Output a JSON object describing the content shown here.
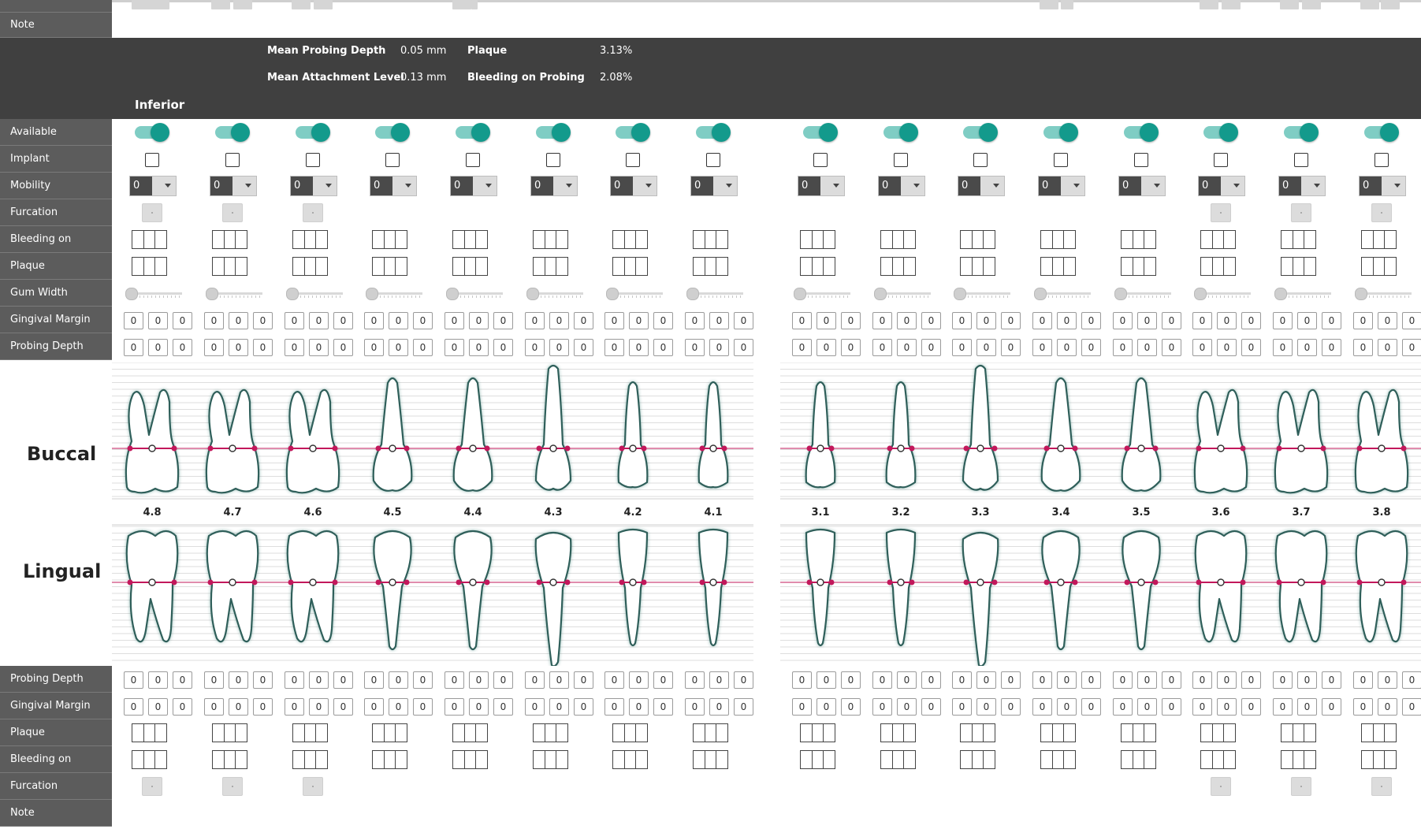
{
  "top_rows": {
    "note": "Note"
  },
  "stats": {
    "mean_probing_depth_label": "Mean Probing Depth",
    "mean_probing_depth_value": "0.05 mm",
    "mean_attachment_level_label": "Mean Attachment Level",
    "mean_attachment_level_value": "0.13 mm",
    "plaque_label": "Plaque",
    "plaque_value": "3.13%",
    "bleeding_label": "Bleeding on Probing",
    "bleeding_value": "2.08%"
  },
  "jaw": "Inferior",
  "rows_upper": [
    "Available",
    "Implant",
    "Mobility",
    "Furcation",
    "Bleeding on Probing",
    "Plaque",
    "Gum Width",
    "Gingival Margin",
    "Probing Depth"
  ],
  "rows_lower": [
    "Probing Depth",
    "Gingival Margin",
    "Plaque",
    "Bleeding on Probing",
    "Furcation",
    "Note"
  ],
  "section_labels": {
    "buccal": "Buccal",
    "lingual": "Lingual"
  },
  "teeth": [
    "4.8",
    "4.7",
    "4.6",
    "4.5",
    "4.4",
    "4.3",
    "4.2",
    "4.1",
    "3.1",
    "3.2",
    "3.3",
    "3.4",
    "3.5",
    "3.6",
    "3.7",
    "3.8"
  ],
  "mobility_value": "0",
  "measure_value": "0",
  "furcation_teeth": [
    "4.8",
    "4.7",
    "4.6",
    "3.6",
    "3.7",
    "3.8"
  ],
  "colors": {
    "accent": "#139a8c",
    "accent_light": "#7fcdc4",
    "margin_line": "#c2185b",
    "label_bg": "#5c5c5c",
    "band_bg": "#404040"
  }
}
